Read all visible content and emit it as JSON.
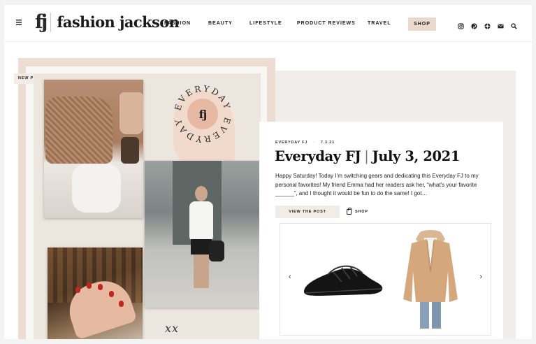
{
  "header": {
    "logo_mark": "fj",
    "logo_text": "fashion jackson",
    "nav": [
      {
        "label": "FASHION"
      },
      {
        "label": "BEAUTY"
      },
      {
        "label": "LIFESTYLE"
      },
      {
        "label": "PRODUCT REVIEWS"
      },
      {
        "label": "TRAVEL"
      }
    ],
    "shop_label": "SHOP",
    "icons": [
      "instagram-icon",
      "pinterest-icon",
      "shop-icon",
      "email-icon",
      "search-icon"
    ]
  },
  "hero": {
    "badge": "NEW POST!",
    "circle_text": "EVERYDAY",
    "circle_mark": "fj",
    "signature": "xx"
  },
  "post": {
    "category": "EVERYDAY FJ",
    "date": "7.3.21",
    "title_left": "Everyday FJ",
    "title_sep": "|",
    "title_right": "July 3, 2021",
    "excerpt": "Happy Saturday! Today I’m switching gears and dedicating this Everyday FJ to my personal favorites! My friend Emma had her readers ask her, “what’s your favorite ______”, and I thought it would be fun to do the same! I got…",
    "view_label": "VIEW THE POST",
    "shop_label": "SHOP"
  },
  "products": [
    "black-woven-slide-sandal",
    "camel-blazer"
  ],
  "colors": {
    "accent_blush": "#ecdcd2",
    "shop_button": "#ead9cd",
    "circle_pink": "#e7b8a3"
  }
}
